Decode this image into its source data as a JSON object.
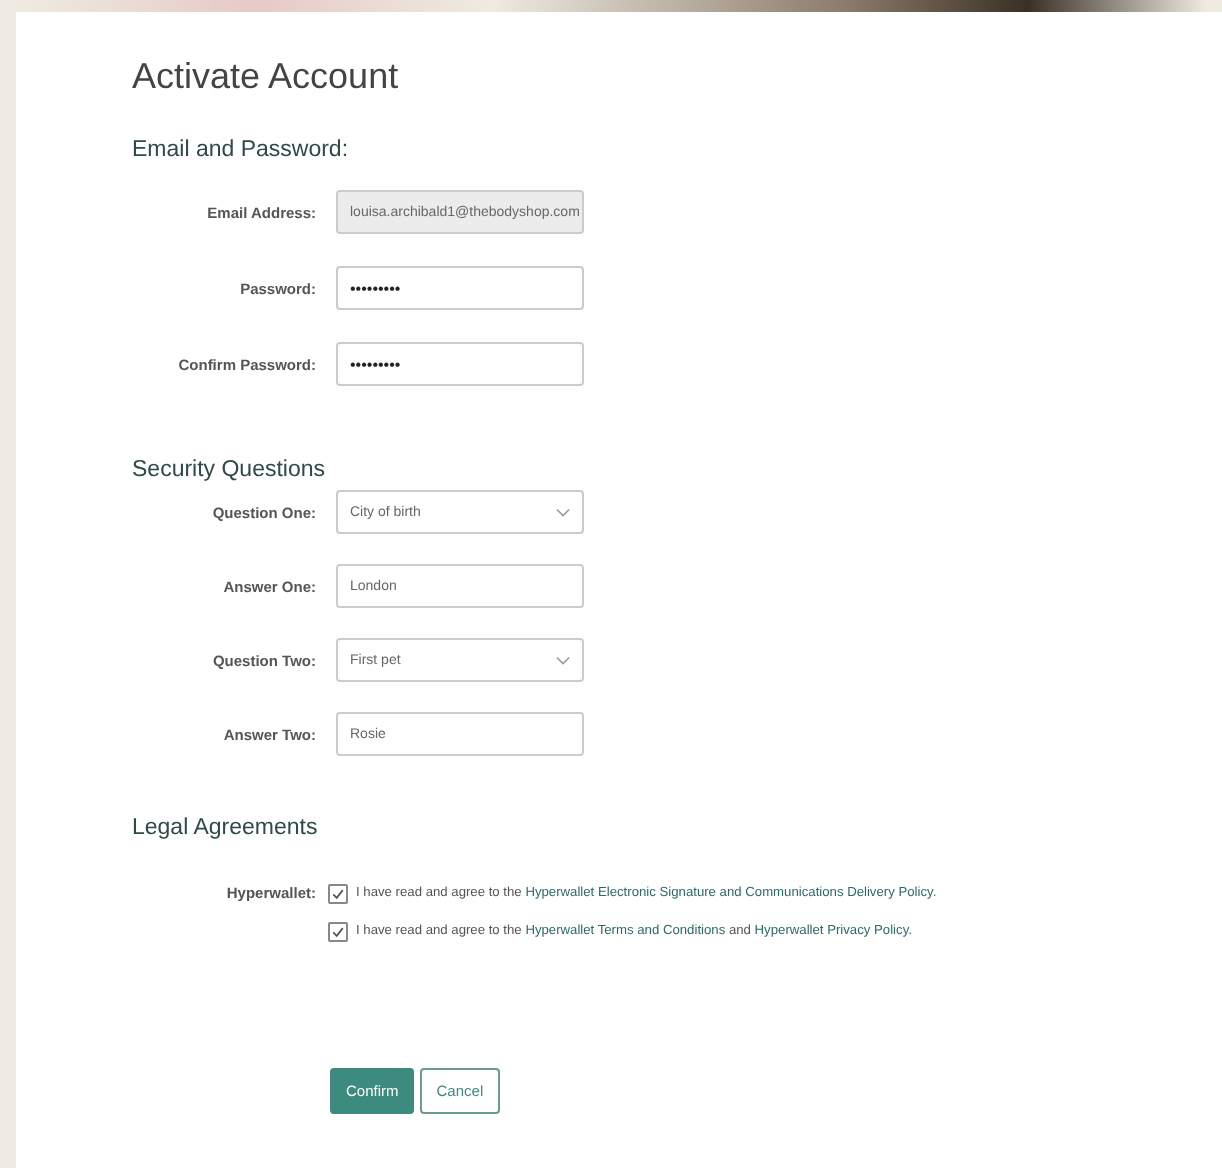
{
  "title": "Activate Account",
  "sections": [
    {
      "heading": "Email and Password:",
      "fields": [
        {
          "label": "Email Address:",
          "kind": "text",
          "value": "louisa.archibald1@thebodyshop.com",
          "disabled": true
        },
        {
          "label": "Password:",
          "kind": "password",
          "value": "•••••••••",
          "disabled": false
        },
        {
          "label": "Confirm Password:",
          "kind": "password",
          "value": "•••••••••",
          "disabled": false
        }
      ]
    },
    {
      "heading": "Security Questions",
      "fields": [
        {
          "label": "Question One:",
          "kind": "select",
          "value": "City of birth",
          "disabled": false
        },
        {
          "label": "Answer One:",
          "kind": "text",
          "value": "London",
          "disabled": false
        },
        {
          "label": "Question Two:",
          "kind": "select",
          "value": "First pet",
          "disabled": false
        },
        {
          "label": "Answer Two:",
          "kind": "text",
          "value": "Rosie",
          "disabled": false
        }
      ]
    }
  ],
  "legal": {
    "heading": "Legal Agreements",
    "label": "Hyperwallet:",
    "agreements": [
      {
        "checked": true,
        "parts": [
          {
            "text": "I have read and agree to the ",
            "link": false
          },
          {
            "text": "Hyperwallet Electronic Signature and Communications Delivery Policy",
            "link": true
          },
          {
            "text": ".",
            "link": false
          }
        ]
      },
      {
        "checked": true,
        "parts": [
          {
            "text": "I have read and agree to the ",
            "link": false
          },
          {
            "text": "Hyperwallet Terms and Conditions",
            "link": true
          },
          {
            "text": " and ",
            "link": false
          },
          {
            "text": "Hyperwallet Privacy Policy",
            "link": true
          },
          {
            "text": ".",
            "link": false
          }
        ]
      }
    ]
  },
  "buttons": [
    {
      "label": "Confirm",
      "kind": "primary"
    },
    {
      "label": "Cancel",
      "kind": "secondary"
    }
  ]
}
